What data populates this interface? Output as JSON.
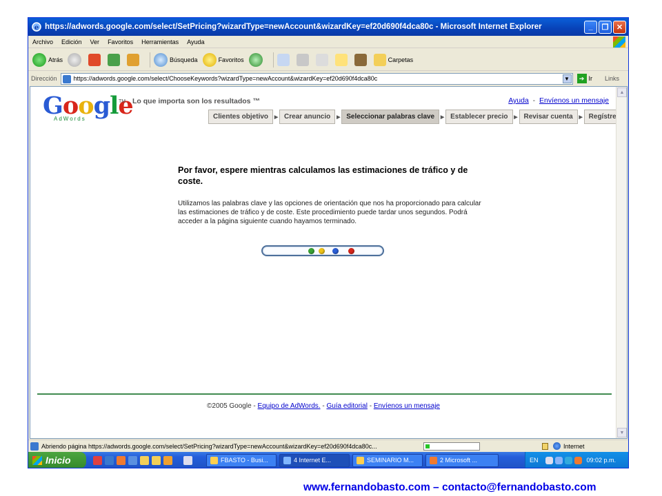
{
  "window": {
    "title": "https://adwords.google.com/select/SetPricing?wizardType=newAccount&wizardKey=ef20d690f4dca80c - Microsoft Internet Explorer",
    "btn_min": "_",
    "btn_max": "❐",
    "btn_close": "✕"
  },
  "menu": [
    "Archivo",
    "Edición",
    "Ver",
    "Favoritos",
    "Herramientas",
    "Ayuda"
  ],
  "toolbar": {
    "back": "Atrás",
    "search": "Búsqueda",
    "favorites": "Favoritos",
    "folders": "Carpetas"
  },
  "address": {
    "label": "Dirección",
    "url": "https://adwords.google.com/select/ChooseKeywords?wizardType=newAccount&wizardKey=ef20d690f4dca80c",
    "go": "Ir",
    "links": "Links"
  },
  "page": {
    "logo_sub": "AdWords",
    "logo_tm": "TM",
    "tagline": "Lo que importa son los resultados ™",
    "help": "Ayuda",
    "sep": "-",
    "contact": "Envíenos un mensaje",
    "steps": [
      "Clientes objetivo",
      "Crear anuncio",
      "Seleccionar palabras clave",
      "Establecer precio",
      "Revisar cuenta",
      "Regístrese"
    ],
    "active_step": 2,
    "wait_title": "Por favor, espere mientras calculamos las estimaciones de tráfico y de coste.",
    "wait_body": "Utilizamos las palabras clave y las opciones de orientación que nos ha proporcionado para calcular las estimaciones de tráfico y de coste. Este procedimiento puede tardar unos segundos. Podrá acceder a la página siguiente cuando hayamos terminado.",
    "dot_colors": [
      "#3aa335",
      "#f0c419",
      "#2b5fd8",
      "#d8261b"
    ],
    "footer_copy": "©2005 Google - ",
    "footer_link1": "Equipo de AdWords.",
    "footer_sep1": " - ",
    "footer_link2": "Guía editorial",
    "footer_sep2": " - ",
    "footer_link3": "Envíenos un mensaje"
  },
  "status": {
    "text": "Abriendo página https://adwords.google.com/select/SetPricing?wizardType=newAccount&wizardKey=ef20d690f4dca80c...",
    "progress": 0.08,
    "zone": "Internet"
  },
  "taskbar": {
    "start": "Inicio",
    "tasks": [
      "FBASTO - Busi...",
      "4 Internet E...",
      "SEMINARIO M...",
      "2 Microsoft ..."
    ],
    "lang": "EN",
    "clock": "09:02 p.m."
  },
  "watermark": "www.fernandobasto.com – contacto@fernandobasto.com"
}
